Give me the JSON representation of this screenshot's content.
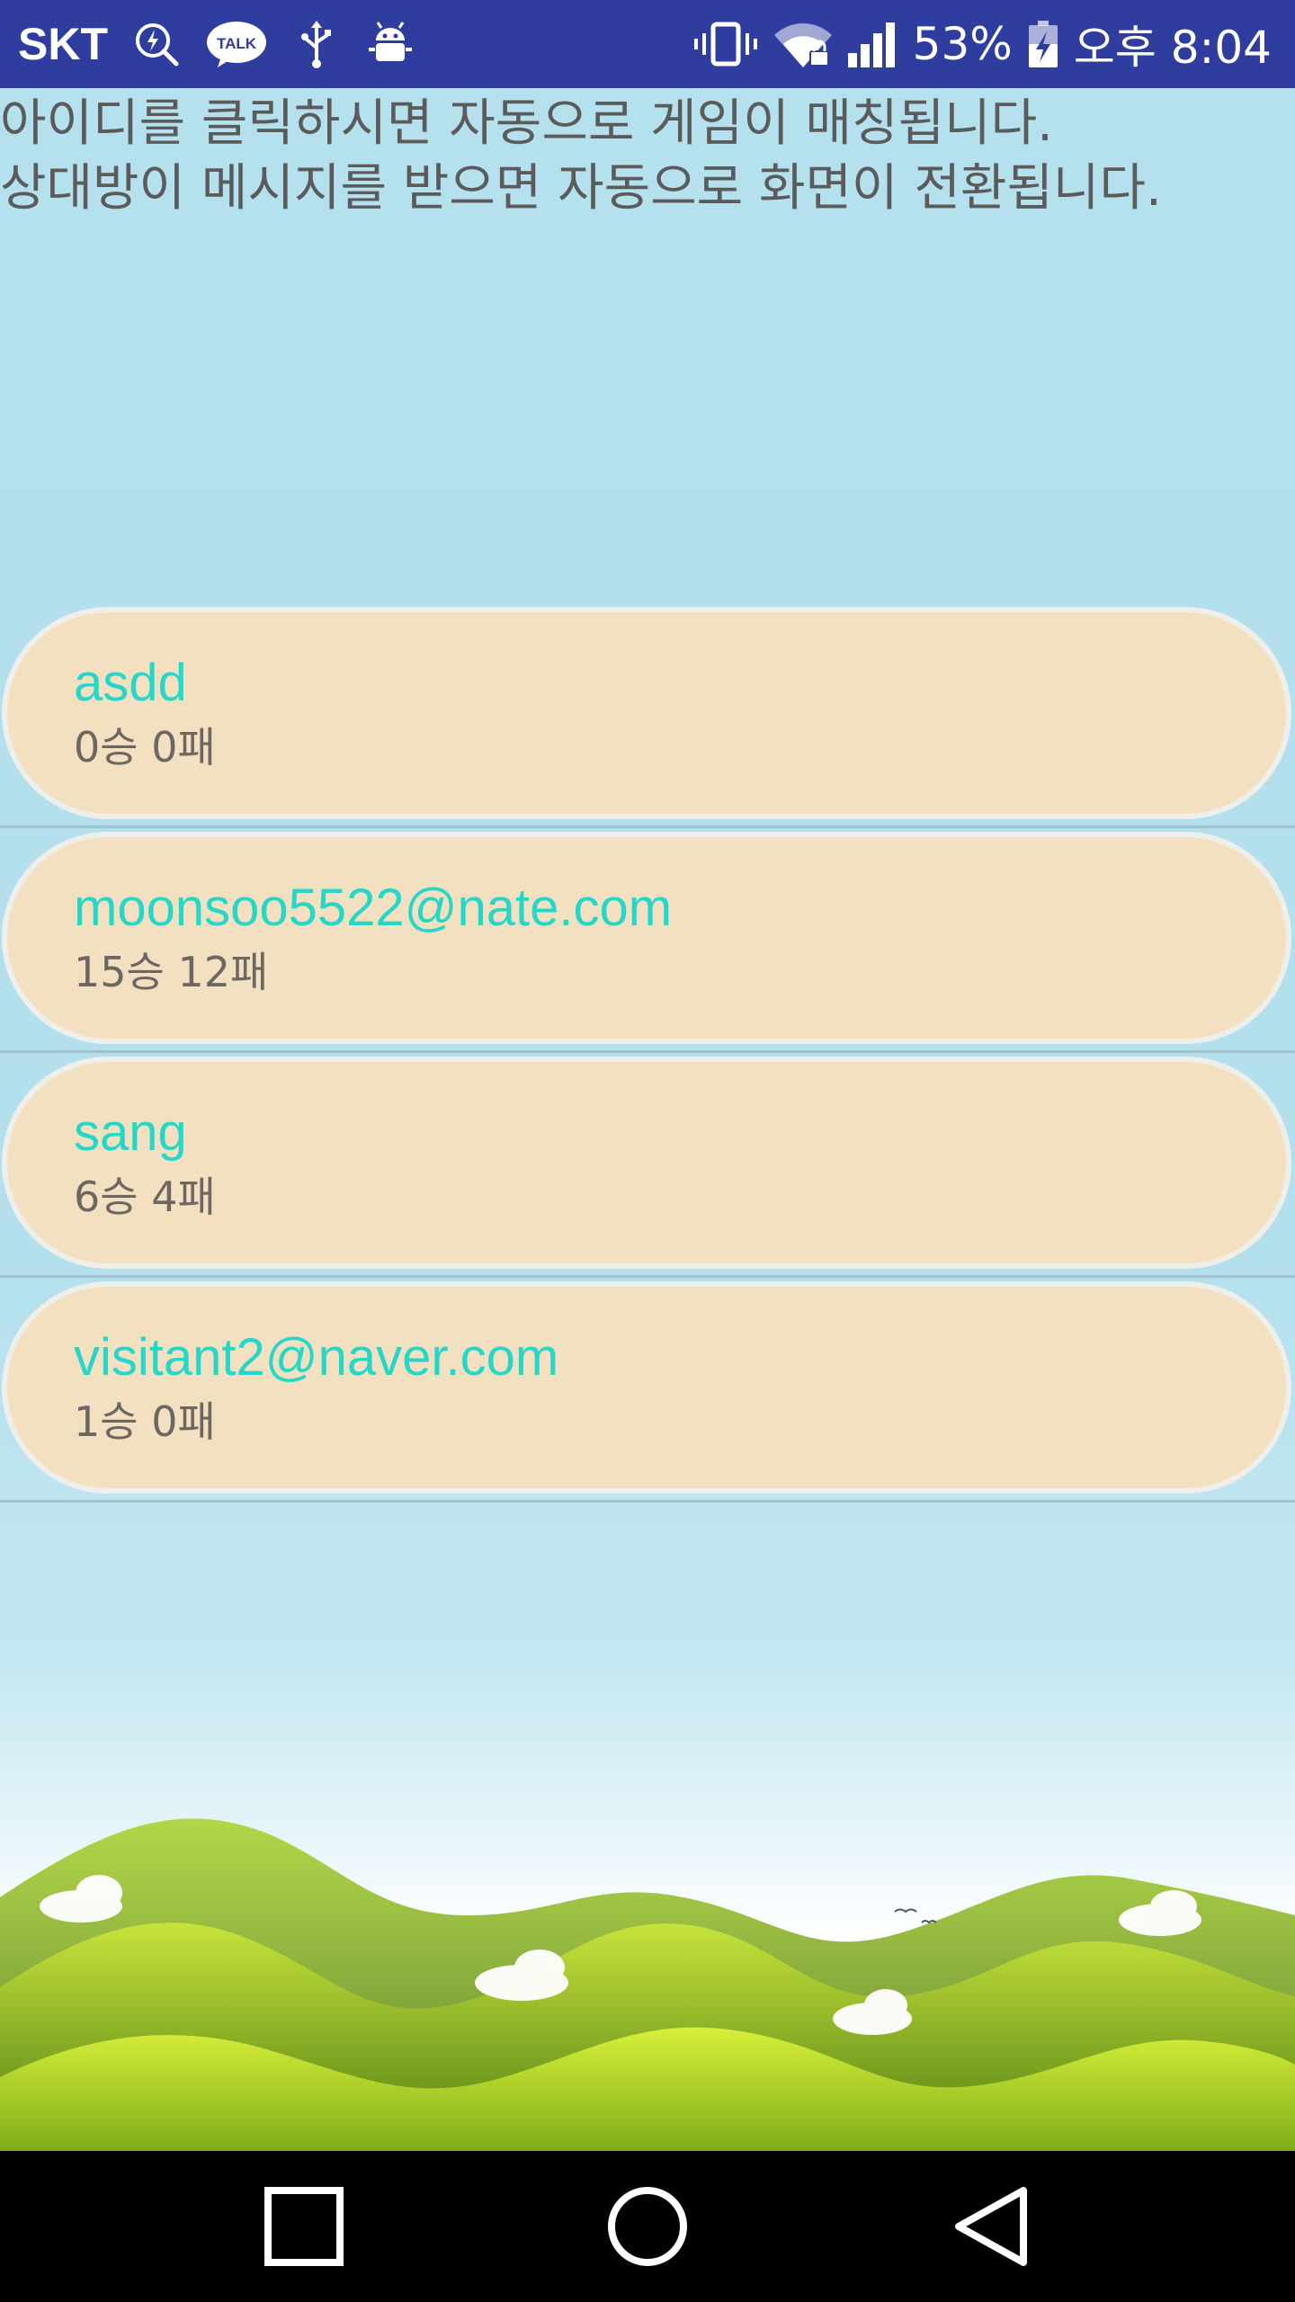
{
  "status_bar": {
    "carrier": "SKT",
    "battery": "53%",
    "time": "오후 8:04",
    "icons_left": [
      "charge-search-icon",
      "kakaotalk-icon",
      "usb-icon",
      "android-debug-icon"
    ],
    "icons_right": [
      "vibrate-icon",
      "wifi-lock-icon",
      "signal-icon",
      "battery-charging-icon"
    ],
    "color": "#2e3d9e"
  },
  "instructions": {
    "line1": "아이디를 클릭하시면 자동으로 게임이 매칭됩니다.",
    "line2": "상대방이 메시지를 받으면 자동으로 화면이 전환됩니다."
  },
  "users": [
    {
      "id": "asdd",
      "record": "0승 0패"
    },
    {
      "id": "moonsoo5522@nate.com",
      "record": "15승 12패"
    },
    {
      "id": "sang",
      "record": "6승 4패"
    },
    {
      "id": "visitant2@naver.com",
      "record": "1승 0패"
    }
  ],
  "colors": {
    "background": "#b5e0ee",
    "card": "#f3e0c1",
    "user_id": "#25d7c8",
    "record": "#6d6761"
  },
  "nav_bar": {
    "buttons": [
      "recent-apps-icon",
      "home-icon",
      "back-icon"
    ]
  }
}
